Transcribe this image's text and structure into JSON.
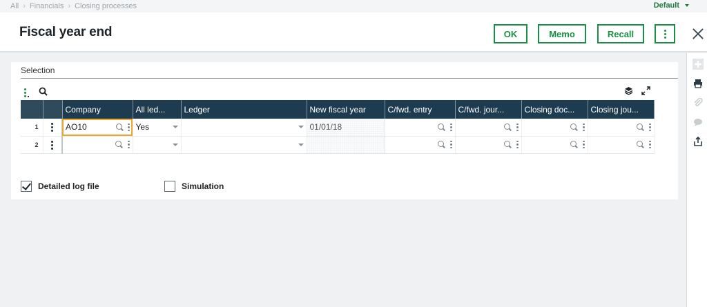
{
  "breadcrumb": [
    "All",
    "Financials",
    "Closing processes"
  ],
  "profile": {
    "label": "Default"
  },
  "header": {
    "title": "Fiscal year end",
    "buttons": {
      "ok": "OK",
      "memo": "Memo",
      "recall": "Recall"
    }
  },
  "selection": {
    "title": "Selection",
    "columns": [
      "Company",
      "All led...",
      "Ledger",
      "New fiscal year",
      "C/fwd. entry",
      "C/fwd. jour...",
      "Closing doc...",
      "Closing jou..."
    ],
    "rows": [
      {
        "num": "1",
        "company": "AO10",
        "all_ledgers": "Yes",
        "ledger": "",
        "new_fiscal_year": "01/01/18",
        "cfwd_entry": "",
        "cfwd_journal": "",
        "closing_doc": "",
        "closing_journal": ""
      },
      {
        "num": "2",
        "company": "",
        "all_ledgers": "",
        "ledger": "",
        "new_fiscal_year": "",
        "cfwd_entry": "",
        "cfwd_journal": "",
        "closing_doc": "",
        "closing_journal": ""
      }
    ]
  },
  "options": {
    "detailed_log": {
      "label": "Detailed log file",
      "checked": true
    },
    "simulation": {
      "label": "Simulation",
      "checked": false
    }
  },
  "icons": {
    "rail": [
      "plus-icon",
      "print-icon",
      "attachment-icon",
      "comment-icon",
      "export-icon"
    ],
    "toolbar": [
      "grid-menu-icon",
      "search-icon",
      "layers-icon",
      "expand-icon"
    ]
  },
  "colors": {
    "accent": "#178f45",
    "grid_header": "#1e3c4f",
    "active_cell": "#f0a52b"
  }
}
